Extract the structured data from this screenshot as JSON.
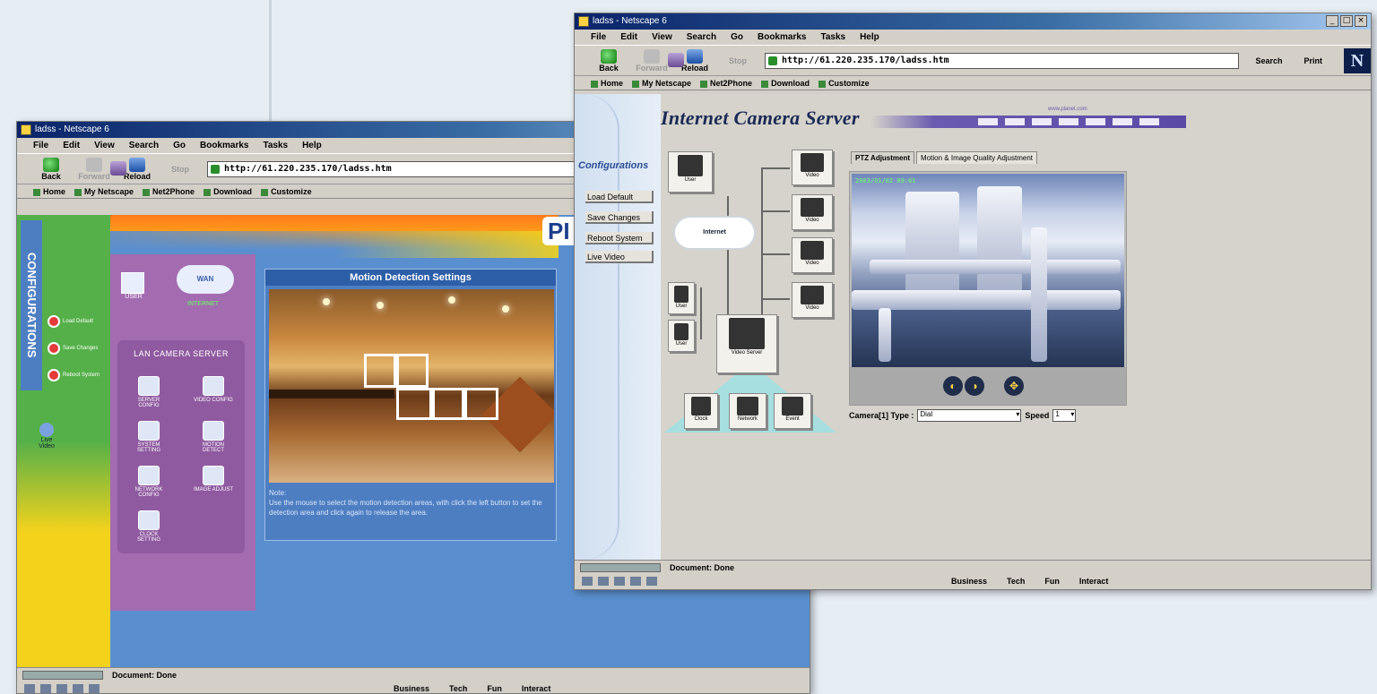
{
  "winA": {
    "title": "ladss - Netscape 6",
    "menu": [
      "File",
      "Edit",
      "View",
      "Search",
      "Go",
      "Bookmarks",
      "Tasks",
      "Help"
    ],
    "nav": [
      "Back",
      "Forward",
      "Reload",
      "Stop"
    ],
    "address": "http://61.220.235.170/ladss.htm",
    "links": [
      "Home",
      "My Netscape",
      "Net2Phone",
      "Download",
      "Customize"
    ],
    "sidebar": {
      "title": "CONFIGURATIONS",
      "buttons": [
        "Load Default",
        "Save Changes",
        "Reboot System"
      ],
      "live": "Live Video"
    },
    "logo": "PI",
    "topology": {
      "user": "USER",
      "cloud": "WAN",
      "internet": "INTERNET",
      "lan_title": "LAN CAMERA SERVER",
      "items": [
        "SERVER CONFIG",
        "VIDEO CONFIG",
        "SYSTEM SETTING",
        "MOTION DETECT",
        "NETWORK CONFIG",
        "IMAGE ADJUST",
        "CLOCK SETTING"
      ]
    },
    "motion": {
      "header": "Motion Detection Settings",
      "note_title": "Note:",
      "note": "Use the mouse to select the motion detection areas, with click the left button to set the detection area and click again to release the area."
    },
    "status": "Document: Done",
    "bottom": [
      "Business",
      "Tech",
      "Fun",
      "Interact"
    ]
  },
  "winB": {
    "title": "ladss - Netscape 6",
    "menu": [
      "File",
      "Edit",
      "View",
      "Search",
      "Go",
      "Bookmarks",
      "Tasks",
      "Help"
    ],
    "nav": [
      "Back",
      "Forward",
      "Reload",
      "Stop"
    ],
    "address": "http://61.220.235.170/ladss.htm",
    "search": "Search",
    "print": "Print",
    "links": [
      "Home",
      "My Netscape",
      "Net2Phone",
      "Download",
      "Customize"
    ],
    "heading": "Internet Camera Server",
    "url_small": "www.planet.com",
    "left": {
      "title": "Configurations",
      "links": [
        "Load Default",
        "Save Changes",
        "Reboot System",
        "Live Video"
      ]
    },
    "topology": {
      "user": "User",
      "internet": "Internet",
      "video": "Video",
      "server": "Video Server",
      "bottom": [
        "Clock",
        "Network",
        "Event"
      ]
    },
    "tabs": [
      "PTZ Adjustment",
      "Motion & Image Quality Adjustment"
    ],
    "camera": {
      "timestamp": "2003/01/02 09:01",
      "label": "Camera[1] Type :",
      "type_value": "Dial",
      "speed_label": "Speed",
      "speed_value": "1"
    },
    "status": "Document: Done",
    "bottom": [
      "Business",
      "Tech",
      "Fun",
      "Interact"
    ]
  }
}
